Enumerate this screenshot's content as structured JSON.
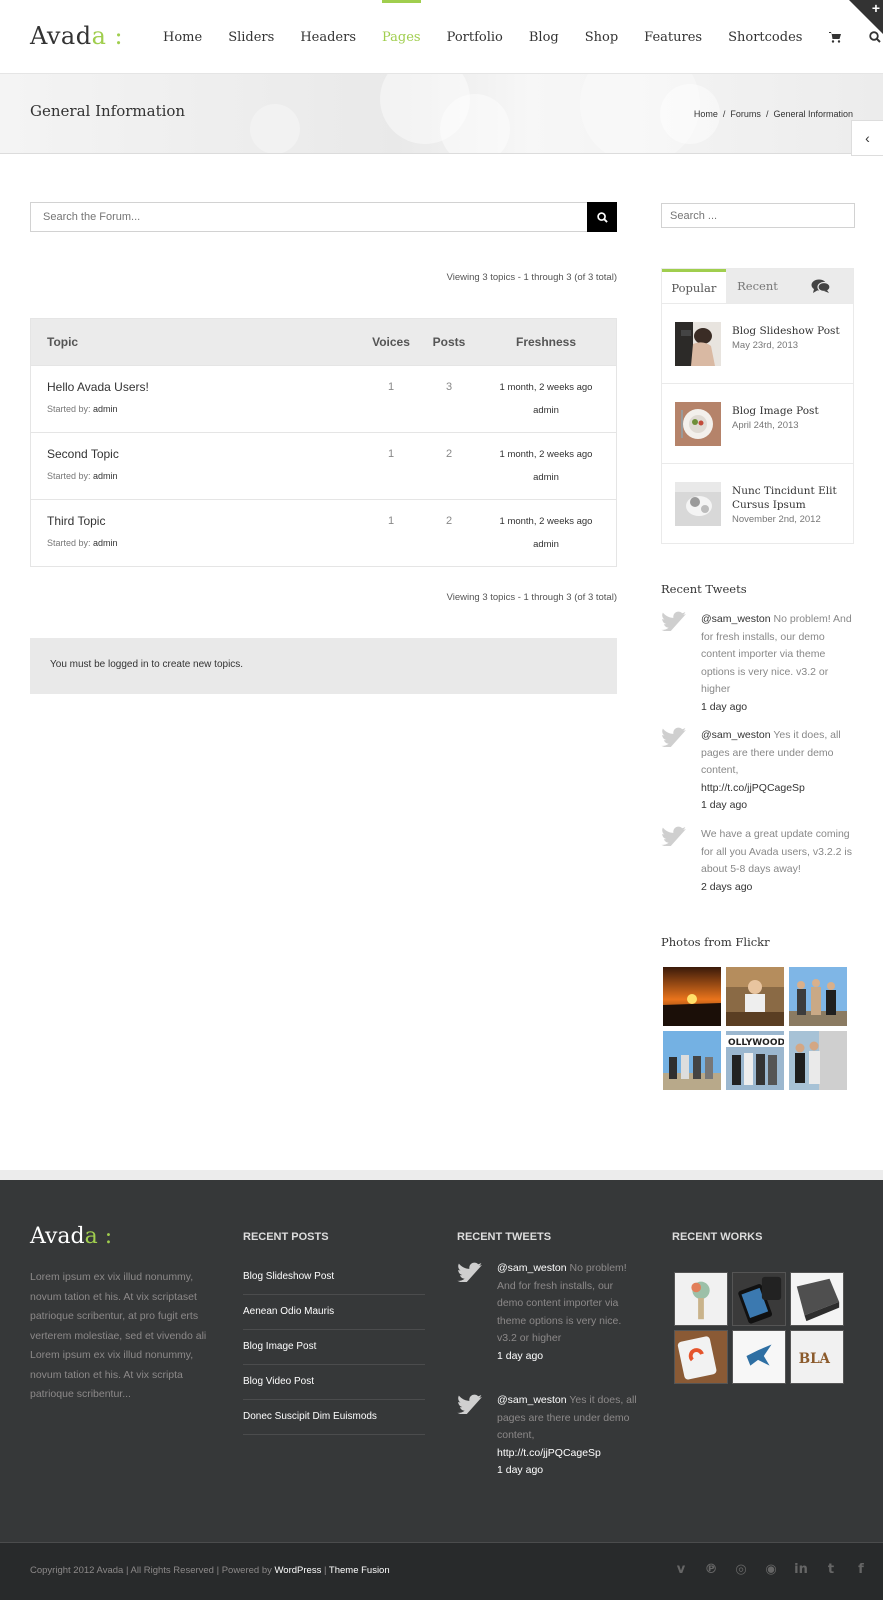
{
  "brand": {
    "logo_main": "Avada",
    "logo_accent": "a :",
    "logo_prefix": "Avad",
    "accent_color": "#a0ce4e"
  },
  "nav": {
    "items": [
      {
        "label": "Home"
      },
      {
        "label": "Sliders"
      },
      {
        "label": "Headers"
      },
      {
        "label": "Pages",
        "active": true
      },
      {
        "label": "Portfolio"
      },
      {
        "label": "Blog"
      },
      {
        "label": "Shop"
      },
      {
        "label": "Features"
      },
      {
        "label": "Shortcodes"
      }
    ],
    "cart_icon": "cart-icon",
    "search_icon": "search-icon"
  },
  "titlebar": {
    "title": "General Information",
    "breadcrumb": [
      "Home",
      "/",
      "Forums",
      "/",
      "General Information"
    ]
  },
  "forum": {
    "search_placeholder": "Search the Forum...",
    "viewing_top": "Viewing 3 topics - 1 through 3 (of 3 total)",
    "viewing_bottom": "Viewing 3 topics - 1 through 3 (of 3 total)",
    "headers": {
      "topic": "Topic",
      "voices": "Voices",
      "posts": "Posts",
      "freshness": "Freshness"
    },
    "started_label": "Started by:",
    "topics": [
      {
        "title": "Hello Avada Users!",
        "author": "admin",
        "voices": "1",
        "posts": "3",
        "freshness": "1 month, 2 weeks ago",
        "last_by": "admin"
      },
      {
        "title": "Second Topic",
        "author": "admin",
        "voices": "1",
        "posts": "2",
        "freshness": "1 month, 2 weeks ago",
        "last_by": "admin"
      },
      {
        "title": "Third Topic",
        "author": "admin",
        "voices": "1",
        "posts": "2",
        "freshness": "1 month, 2 weeks ago",
        "last_by": "admin"
      }
    ],
    "login_notice": "You must be logged in to create new topics."
  },
  "sidebar": {
    "search_placeholder": "Search ...",
    "tabs": {
      "popular": "Popular",
      "recent": "Recent",
      "comments_icon": "comments-icon"
    },
    "popular_posts": [
      {
        "title": "Blog Slideshow Post",
        "date": "May 23rd, 2013"
      },
      {
        "title": "Blog Image Post",
        "date": "April 24th, 2013"
      },
      {
        "title": "Nunc Tincidunt Elit Cursus Ipsum",
        "date": "November 2nd, 2012"
      }
    ],
    "tweets_title": "Recent Tweets",
    "tweets": [
      {
        "handle": "@sam_weston",
        "text": " No problem! And for fresh installs, our demo content importer via theme options is very nice. v3.2 or higher",
        "link": "",
        "ago": "1 day ago"
      },
      {
        "handle": "@sam_weston",
        "text": " Yes it does, all pages are there under demo content, ",
        "link": "http://t.co/jjPQCageSp",
        "ago": "1 day ago"
      },
      {
        "handle": "",
        "text": "We have a great update coming for all you Avada users, v3.2.2 is about 5-8 days away!",
        "link": "",
        "ago": "2 days ago"
      }
    ],
    "flickr_title": "Photos from Flickr"
  },
  "footer": {
    "about": "Lorem ipsum ex vix illud nonummy, novum tation et his. At vix scriptaset patrioque scribentur, at pro fugit erts verterem molestiae, sed et vivendo ali Lorem ipsum ex vix illud nonummy, novum tation et his. At vix scripta patrioque scribentur...",
    "recent_posts_title": "RECENT POSTS",
    "recent_posts": [
      "Blog Slideshow Post",
      "Aenean Odio Mauris",
      "Blog Image Post",
      "Blog Video Post",
      "Donec Suscipit Dim Euismods"
    ],
    "recent_tweets_title": "RECENT TWEETS",
    "tweets": [
      {
        "handle": "@sam_weston",
        "text": " No problem! And for fresh installs, our demo content importer via theme options is very nice. v3.2 or higher",
        "link": "",
        "ago": "1 day ago"
      },
      {
        "handle": "@sam_weston",
        "text": " Yes it does, all pages are there under demo content, ",
        "link": "http://t.co/jjPQCageSp",
        "ago": "1 day ago"
      }
    ],
    "recent_works_title": "RECENT WORKS",
    "copyright_prefix": "Copyright 2012 Avada | All Rights Reserved | Powered by ",
    "copyright_link1": "WordPress",
    "copyright_sep": " | ",
    "copyright_link2": "Theme Fusion",
    "social_icons": [
      "vimeo-icon",
      "pinterest-icon",
      "dribbble-icon",
      "rss-icon",
      "linkedin-icon",
      "tumblr-icon",
      "facebook-icon"
    ]
  }
}
